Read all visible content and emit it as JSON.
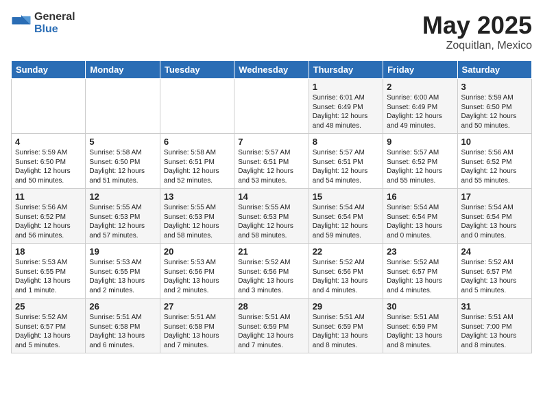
{
  "header": {
    "logo_general": "General",
    "logo_blue": "Blue",
    "title": "May 2025",
    "subtitle": "Zoquitlan, Mexico"
  },
  "days_of_week": [
    "Sunday",
    "Monday",
    "Tuesday",
    "Wednesday",
    "Thursday",
    "Friday",
    "Saturday"
  ],
  "weeks": [
    [
      {
        "day": "",
        "info": ""
      },
      {
        "day": "",
        "info": ""
      },
      {
        "day": "",
        "info": ""
      },
      {
        "day": "",
        "info": ""
      },
      {
        "day": "1",
        "info": "Sunrise: 6:01 AM\nSunset: 6:49 PM\nDaylight: 12 hours\nand 48 minutes."
      },
      {
        "day": "2",
        "info": "Sunrise: 6:00 AM\nSunset: 6:49 PM\nDaylight: 12 hours\nand 49 minutes."
      },
      {
        "day": "3",
        "info": "Sunrise: 5:59 AM\nSunset: 6:50 PM\nDaylight: 12 hours\nand 50 minutes."
      }
    ],
    [
      {
        "day": "4",
        "info": "Sunrise: 5:59 AM\nSunset: 6:50 PM\nDaylight: 12 hours\nand 50 minutes."
      },
      {
        "day": "5",
        "info": "Sunrise: 5:58 AM\nSunset: 6:50 PM\nDaylight: 12 hours\nand 51 minutes."
      },
      {
        "day": "6",
        "info": "Sunrise: 5:58 AM\nSunset: 6:51 PM\nDaylight: 12 hours\nand 52 minutes."
      },
      {
        "day": "7",
        "info": "Sunrise: 5:57 AM\nSunset: 6:51 PM\nDaylight: 12 hours\nand 53 minutes."
      },
      {
        "day": "8",
        "info": "Sunrise: 5:57 AM\nSunset: 6:51 PM\nDaylight: 12 hours\nand 54 minutes."
      },
      {
        "day": "9",
        "info": "Sunrise: 5:57 AM\nSunset: 6:52 PM\nDaylight: 12 hours\nand 55 minutes."
      },
      {
        "day": "10",
        "info": "Sunrise: 5:56 AM\nSunset: 6:52 PM\nDaylight: 12 hours\nand 55 minutes."
      }
    ],
    [
      {
        "day": "11",
        "info": "Sunrise: 5:56 AM\nSunset: 6:52 PM\nDaylight: 12 hours\nand 56 minutes."
      },
      {
        "day": "12",
        "info": "Sunrise: 5:55 AM\nSunset: 6:53 PM\nDaylight: 12 hours\nand 57 minutes."
      },
      {
        "day": "13",
        "info": "Sunrise: 5:55 AM\nSunset: 6:53 PM\nDaylight: 12 hours\nand 58 minutes."
      },
      {
        "day": "14",
        "info": "Sunrise: 5:55 AM\nSunset: 6:53 PM\nDaylight: 12 hours\nand 58 minutes."
      },
      {
        "day": "15",
        "info": "Sunrise: 5:54 AM\nSunset: 6:54 PM\nDaylight: 12 hours\nand 59 minutes."
      },
      {
        "day": "16",
        "info": "Sunrise: 5:54 AM\nSunset: 6:54 PM\nDaylight: 13 hours\nand 0 minutes."
      },
      {
        "day": "17",
        "info": "Sunrise: 5:54 AM\nSunset: 6:54 PM\nDaylight: 13 hours\nand 0 minutes."
      }
    ],
    [
      {
        "day": "18",
        "info": "Sunrise: 5:53 AM\nSunset: 6:55 PM\nDaylight: 13 hours\nand 1 minute."
      },
      {
        "day": "19",
        "info": "Sunrise: 5:53 AM\nSunset: 6:55 PM\nDaylight: 13 hours\nand 2 minutes."
      },
      {
        "day": "20",
        "info": "Sunrise: 5:53 AM\nSunset: 6:56 PM\nDaylight: 13 hours\nand 2 minutes."
      },
      {
        "day": "21",
        "info": "Sunrise: 5:52 AM\nSunset: 6:56 PM\nDaylight: 13 hours\nand 3 minutes."
      },
      {
        "day": "22",
        "info": "Sunrise: 5:52 AM\nSunset: 6:56 PM\nDaylight: 13 hours\nand 4 minutes."
      },
      {
        "day": "23",
        "info": "Sunrise: 5:52 AM\nSunset: 6:57 PM\nDaylight: 13 hours\nand 4 minutes."
      },
      {
        "day": "24",
        "info": "Sunrise: 5:52 AM\nSunset: 6:57 PM\nDaylight: 13 hours\nand 5 minutes."
      }
    ],
    [
      {
        "day": "25",
        "info": "Sunrise: 5:52 AM\nSunset: 6:57 PM\nDaylight: 13 hours\nand 5 minutes."
      },
      {
        "day": "26",
        "info": "Sunrise: 5:51 AM\nSunset: 6:58 PM\nDaylight: 13 hours\nand 6 minutes."
      },
      {
        "day": "27",
        "info": "Sunrise: 5:51 AM\nSunset: 6:58 PM\nDaylight: 13 hours\nand 7 minutes."
      },
      {
        "day": "28",
        "info": "Sunrise: 5:51 AM\nSunset: 6:59 PM\nDaylight: 13 hours\nand 7 minutes."
      },
      {
        "day": "29",
        "info": "Sunrise: 5:51 AM\nSunset: 6:59 PM\nDaylight: 13 hours\nand 8 minutes."
      },
      {
        "day": "30",
        "info": "Sunrise: 5:51 AM\nSunset: 6:59 PM\nDaylight: 13 hours\nand 8 minutes."
      },
      {
        "day": "31",
        "info": "Sunrise: 5:51 AM\nSunset: 7:00 PM\nDaylight: 13 hours\nand 8 minutes."
      }
    ]
  ]
}
